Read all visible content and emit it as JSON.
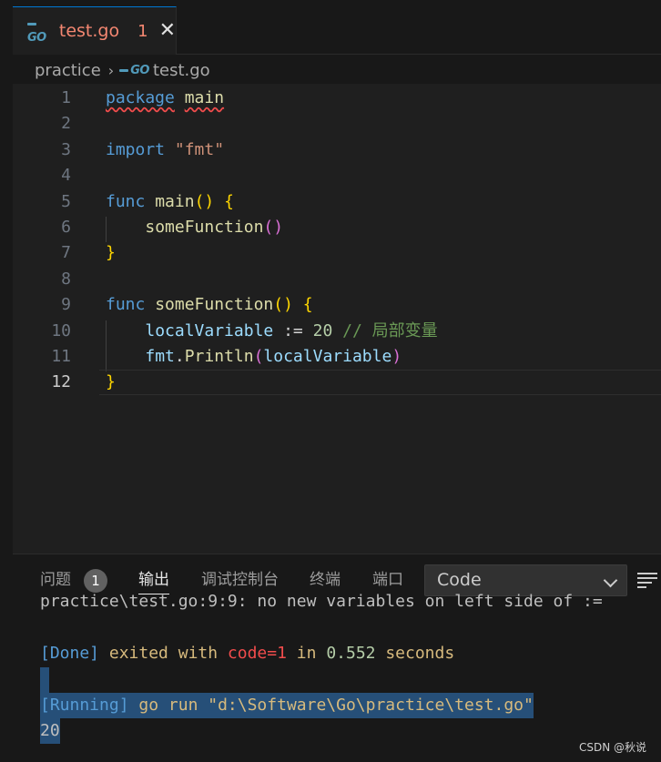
{
  "tab": {
    "filename": "test.go",
    "problem_count": "1",
    "close_glyph": "✕"
  },
  "breadcrumb": {
    "folder": "practice",
    "separator": "›",
    "file": "test.go"
  },
  "icons": {
    "go_file_icon": "GO"
  },
  "editor": {
    "active_line": 12,
    "lines": [
      {
        "num": "1",
        "tokens": [
          [
            "kw squiggle",
            "package"
          ],
          [
            "plain",
            " "
          ],
          [
            "fn squiggle",
            "main"
          ]
        ]
      },
      {
        "num": "2",
        "tokens": []
      },
      {
        "num": "3",
        "tokens": [
          [
            "kw",
            "import"
          ],
          [
            "plain",
            " "
          ],
          [
            "str",
            "\"fmt\""
          ]
        ]
      },
      {
        "num": "4",
        "tokens": []
      },
      {
        "num": "5",
        "tokens": [
          [
            "kw",
            "func"
          ],
          [
            "plain",
            " "
          ],
          [
            "fn",
            "main"
          ],
          [
            "p1",
            "()"
          ],
          [
            "plain",
            " "
          ],
          [
            "p1",
            "{"
          ]
        ]
      },
      {
        "num": "6",
        "tokens": [
          [
            "plain",
            "    "
          ],
          [
            "fn",
            "someFunction"
          ],
          [
            "p2",
            "()"
          ]
        ]
      },
      {
        "num": "7",
        "tokens": [
          [
            "p1",
            "}"
          ]
        ]
      },
      {
        "num": "8",
        "tokens": []
      },
      {
        "num": "9",
        "tokens": [
          [
            "kw",
            "func"
          ],
          [
            "plain",
            " "
          ],
          [
            "fn",
            "someFunction"
          ],
          [
            "p1",
            "()"
          ],
          [
            "plain",
            " "
          ],
          [
            "p1",
            "{"
          ]
        ]
      },
      {
        "num": "10",
        "tokens": [
          [
            "plain",
            "    "
          ],
          [
            "var",
            "localVariable"
          ],
          [
            "plain",
            " := "
          ],
          [
            "num",
            "20"
          ],
          [
            "plain",
            " "
          ],
          [
            "cm",
            "// 局部变量"
          ]
        ]
      },
      {
        "num": "11",
        "tokens": [
          [
            "plain",
            "    "
          ],
          [
            "var",
            "fmt"
          ],
          [
            "plain",
            "."
          ],
          [
            "fn",
            "Println"
          ],
          [
            "p2",
            "("
          ],
          [
            "var",
            "localVariable"
          ],
          [
            "p2",
            ")"
          ]
        ]
      },
      {
        "num": "12",
        "tokens": [
          [
            "p1",
            "}"
          ]
        ]
      }
    ]
  },
  "panel": {
    "tabs": {
      "problems": "问题",
      "problems_count": "1",
      "output": "输出",
      "debug_console": "调试控制台",
      "terminal": "终端",
      "ports": "端口"
    },
    "channel_select": "Code",
    "output_lines": {
      "clipped": "practice\\test.go:9:9: no new variables on left side of :=",
      "done_tag": "[Done]",
      "done_text1": " exited with ",
      "done_code": "code=1",
      "done_text2": " in ",
      "done_time": "0.552",
      "done_text3": " seconds",
      "running_tag": "[Running]",
      "running_cmd": " go run \"d:\\Software\\Go\\practice\\test.go\"",
      "result": "20"
    }
  },
  "watermark": "CSDN @秋说",
  "colors": {
    "accent": "#0078d4",
    "error": "#f14c4c",
    "keyword": "#569cd6",
    "function": "#dcdcaa",
    "string": "#ce9178",
    "number": "#b5cea8",
    "comment": "#6a9955",
    "selection": "#264f78"
  }
}
